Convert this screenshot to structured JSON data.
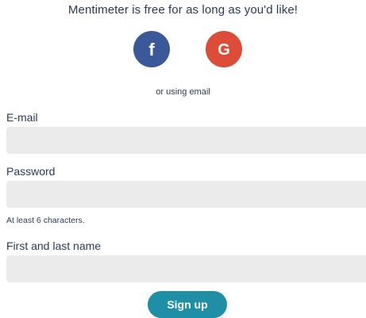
{
  "tagline": "Mentimeter is free for as long as you'd like!",
  "social": {
    "facebook": {
      "icon": "facebook-icon",
      "glyph": "f",
      "color": "#3b5998"
    },
    "google": {
      "icon": "google-icon",
      "glyph": "G",
      "color": "#dd4b39"
    }
  },
  "alt_text": "or using email",
  "fields": {
    "email": {
      "label": "E-mail",
      "value": "",
      "placeholder": ""
    },
    "password": {
      "label": "Password",
      "value": "",
      "placeholder": "",
      "hint": "At least 6 characters."
    },
    "name": {
      "label": "First and last name",
      "value": "",
      "placeholder": ""
    }
  },
  "submit": {
    "label": "Sign up",
    "color": "#1f8fa8"
  }
}
